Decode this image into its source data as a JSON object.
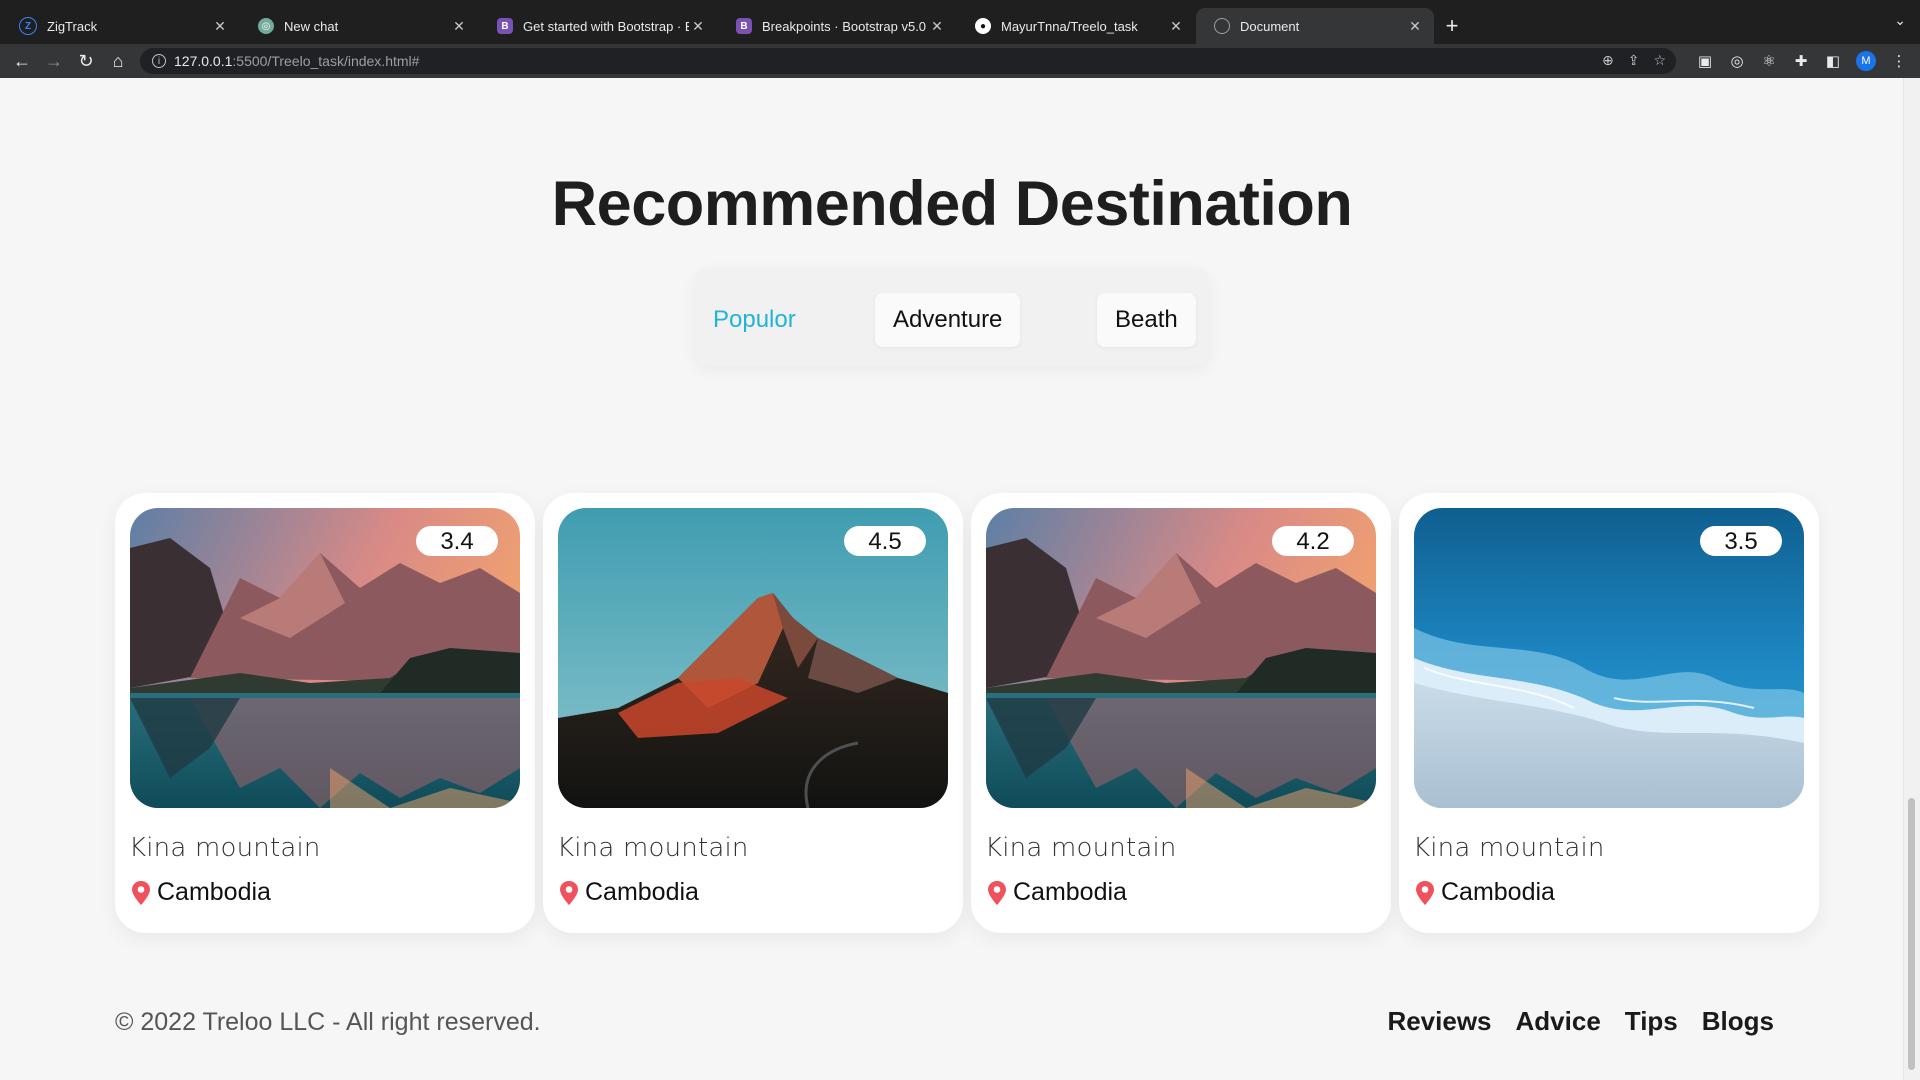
{
  "browser": {
    "tabs": [
      {
        "title": "ZigTrack",
        "icon": "zigtrack-icon",
        "color": "#3b82f6"
      },
      {
        "title": "New chat",
        "icon": "chatgpt-icon",
        "color": "#74aa9c"
      },
      {
        "title": "Get started with Bootstrap · Bo",
        "icon": "bootstrap-icon",
        "color": "#7952b3"
      },
      {
        "title": "Breakpoints · Bootstrap v5.0",
        "icon": "bootstrap-icon",
        "color": "#7952b3"
      },
      {
        "title": "MayurTnna/Treelo_task",
        "icon": "github-icon",
        "color": "#ffffff"
      },
      {
        "title": "Document",
        "icon": "globe-icon",
        "color": "#9aa0a6",
        "active": true
      }
    ],
    "url_host": "127.0.0.1",
    "url_path": ":5500/Treelo_task/index.html#",
    "profile_initial": "M"
  },
  "section": {
    "title": "Recommended Destination",
    "filters": [
      "Populor",
      "Adventure",
      "Beath"
    ],
    "active_filter": "Populor"
  },
  "cards": [
    {
      "rating": "3.4",
      "name": "Kina mountain",
      "country": "Cambodia",
      "image": "lake-mountain"
    },
    {
      "rating": "4.5",
      "name": "Kina mountain",
      "country": "Cambodia",
      "image": "desert-peak"
    },
    {
      "rating": "4.2",
      "name": "Kina mountain",
      "country": "Cambodia",
      "image": "lake-mountain"
    },
    {
      "rating": "3.5",
      "name": "Kina mountain",
      "country": "Cambodia",
      "image": "ocean-beach"
    }
  ],
  "footer": {
    "copyright": "© 2022 Treloo LLC - All right reserved.",
    "links": [
      "Reviews",
      "Advice",
      "Tips",
      "Blogs"
    ]
  },
  "colors": {
    "accent": "#1fb4d8",
    "pin": "#f0525d",
    "page_bg": "#f6f6f6"
  }
}
